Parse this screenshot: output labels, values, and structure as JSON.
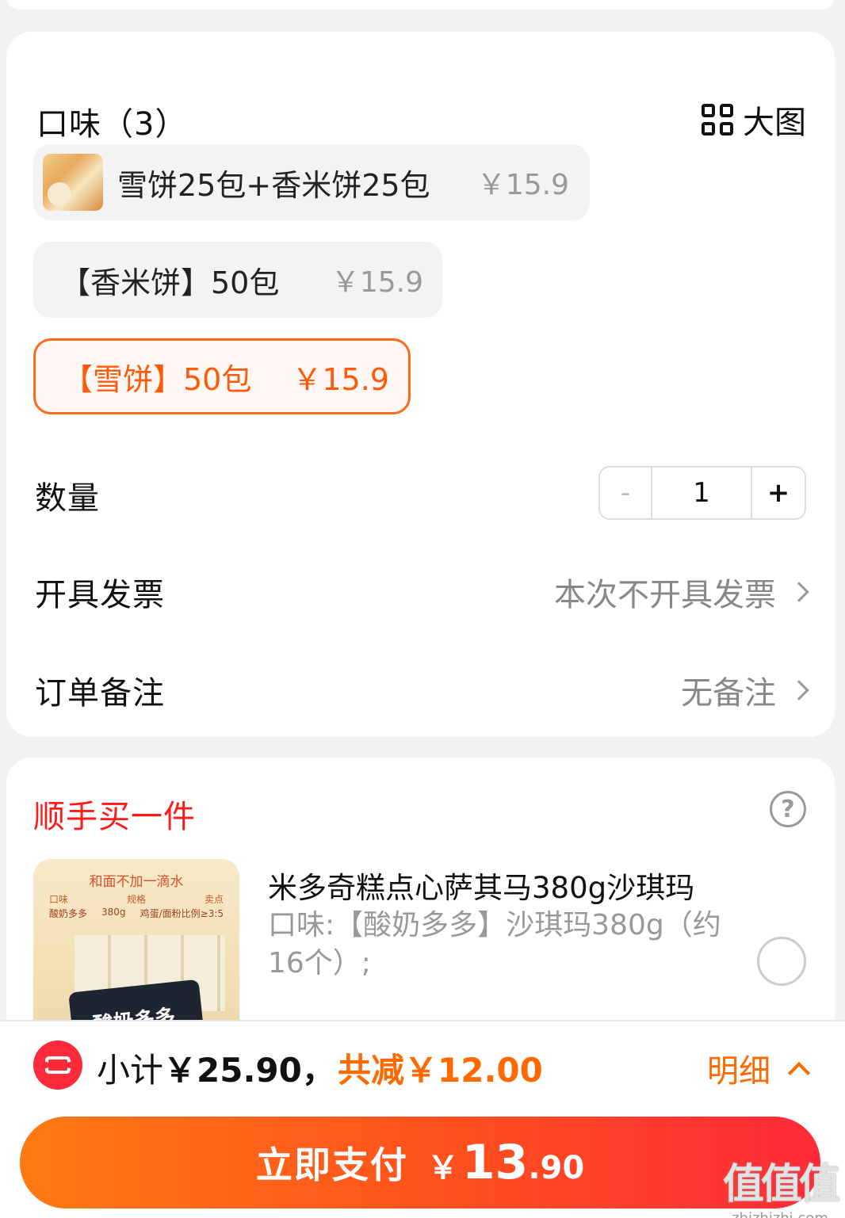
{
  "spec": {
    "flavor_title": "口味（3）",
    "big_view_label": "大图",
    "options": [
      {
        "label": "雪饼25包+香米饼25包",
        "price": "￥15.9",
        "selected": false
      },
      {
        "label": "【香米饼】50包",
        "price": "￥15.9",
        "selected": false
      },
      {
        "label": "【雪饼】50包",
        "price": "￥15.9",
        "selected": true
      }
    ],
    "quantity_label": "数量",
    "quantity": {
      "minus": "-",
      "value": "1",
      "plus": "+"
    },
    "invoice_label": "开具发票",
    "invoice_value": "本次不开具发票",
    "remark_label": "订单备注",
    "remark_value": "无备注"
  },
  "addon": {
    "title": "顺手买一件",
    "help": "?",
    "image_text": {
      "headline": "和面不加一滴水",
      "col1": "口味",
      "col2": "规格",
      "col3": "卖点",
      "val1": "酸奶多多",
      "val2": "380g",
      "val3": "鸡蛋/面粉比例≥3:5",
      "pack": "酸奶多多"
    },
    "product_name": "米多奇糕点心萨其马380g沙琪玛",
    "product_spec": "口味:【酸奶多多】沙琪玛380g（约16个）;"
  },
  "footer": {
    "subtotal_prefix": "小计",
    "subtotal_amount": "￥25.90，",
    "discount": "共减￥12.00",
    "detail_label": "明细",
    "pay_label": "立即支付",
    "pay_currency": "￥",
    "pay_int": "13",
    "pay_dec": ".90"
  },
  "watermark": {
    "logo": "值值值",
    "site": "zhizhizhi.com"
  },
  "colors": {
    "accent": "#ff6a00",
    "red": "#ff1a1a",
    "selected_border": "#ff6a1a"
  }
}
